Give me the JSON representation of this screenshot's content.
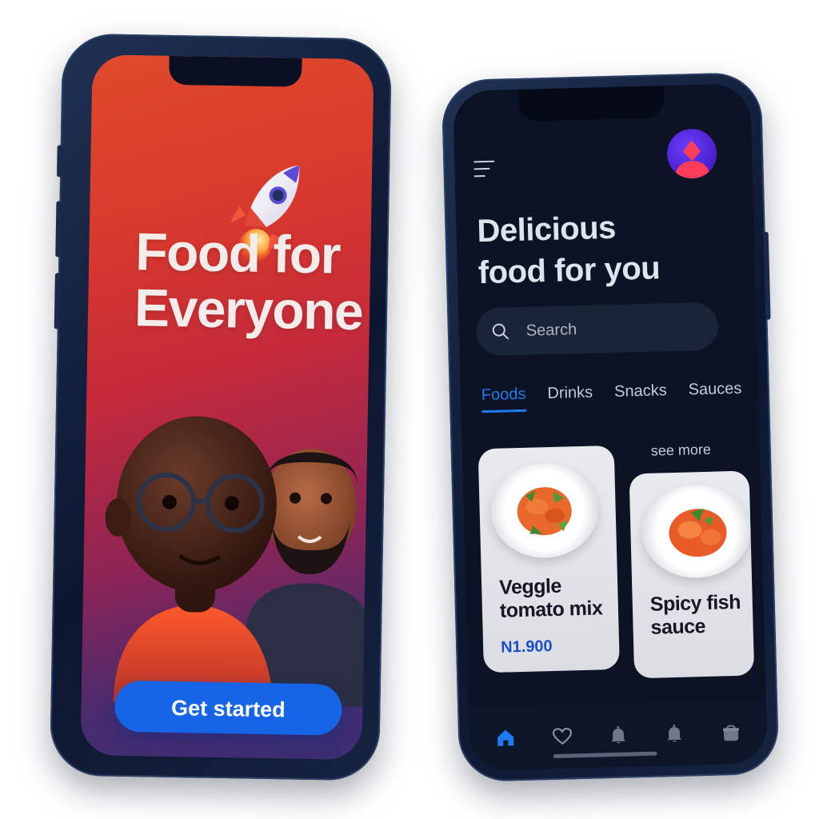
{
  "onboarding": {
    "title_line1": "Food for",
    "title_line2": "Everyone",
    "cta_label": "Get started"
  },
  "home": {
    "title_line1": "Delicious",
    "title_line2": "food for you",
    "search": {
      "placeholder": "Search"
    },
    "tabs": [
      {
        "label": "Foods",
        "active": true
      },
      {
        "label": "Drinks",
        "active": false
      },
      {
        "label": "Snacks",
        "active": false
      },
      {
        "label": "Sauces",
        "active": false
      }
    ],
    "see_more": "see more",
    "cards": [
      {
        "name_line1": "Veggle",
        "name_line2": "tomato mix",
        "price": "N1.900"
      },
      {
        "name_line1": "Spicy fish",
        "name_line2": "sauce"
      }
    ],
    "bottom_nav": [
      {
        "icon": "home-icon",
        "active": true
      },
      {
        "icon": "heart-icon",
        "active": false
      },
      {
        "icon": "bell-icon",
        "active": false
      },
      {
        "icon": "bell-icon",
        "active": false
      },
      {
        "icon": "bag-icon",
        "active": false
      }
    ]
  },
  "colors": {
    "accent": "#1565e6",
    "tab_active": "#1c7cf0",
    "dark_bg": "#0b1324",
    "hero_gradient_top": "#e04a2c",
    "hero_gradient_bottom": "#3a2e72"
  }
}
